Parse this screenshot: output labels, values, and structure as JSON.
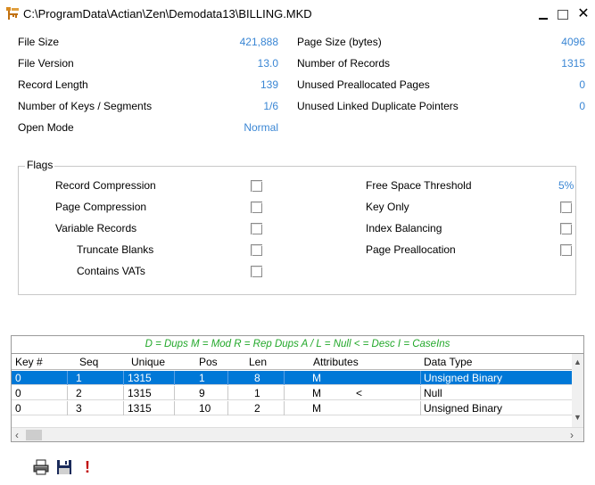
{
  "window": {
    "title": "C:\\ProgramData\\Actian\\Zen\\Demodata13\\BILLING.MKD"
  },
  "info": {
    "left": [
      {
        "label": "File Size",
        "value": "421,888"
      },
      {
        "label": "File Version",
        "value": "13.0"
      },
      {
        "label": "Record Length",
        "value": "139"
      },
      {
        "label": "Number of Keys / Segments",
        "value": "1/6"
      },
      {
        "label": "Open Mode",
        "value": "Normal"
      }
    ],
    "right": [
      {
        "label": "Page Size (bytes)",
        "value": "4096"
      },
      {
        "label": "Number of Records",
        "value": "1315"
      },
      {
        "label": "Unused Preallocated Pages",
        "value": "0"
      },
      {
        "label": "Unused Linked Duplicate Pointers",
        "value": "0"
      }
    ]
  },
  "flags": {
    "title": "Flags",
    "left": [
      {
        "label": "Record Compression",
        "checked": false
      },
      {
        "label": "Page Compression",
        "checked": false
      },
      {
        "label": "Variable Records",
        "checked": false
      },
      {
        "label": "Truncate Blanks",
        "checked": false
      },
      {
        "label": "Contains VATs",
        "checked": false
      }
    ],
    "free_space": {
      "label": "Free Space Threshold",
      "value": "5%"
    },
    "right": [
      {
        "label": "Key Only",
        "checked": false
      },
      {
        "label": "Index Balancing",
        "checked": false
      },
      {
        "label": "Page Preallocation",
        "checked": false
      }
    ]
  },
  "legend": "D = Dups   M = Mod   R = Rep Dups   A / L = Null   < = Desc   I = CaseIns",
  "grid": {
    "columns": [
      "Key #",
      "Seq",
      "Unique",
      "Pos",
      "Len",
      "Attributes",
      "Data Type"
    ],
    "rows": [
      {
        "key": "0",
        "seq": "1",
        "unique": "1315",
        "pos": "1",
        "len": "8",
        "attr1": "M",
        "attr2": "",
        "type": "Unsigned Binary",
        "selected": true
      },
      {
        "key": "0",
        "seq": "2",
        "unique": "1315",
        "pos": "9",
        "len": "1",
        "attr1": "M",
        "attr2": "<",
        "type": "Null",
        "selected": false
      },
      {
        "key": "0",
        "seq": "3",
        "unique": "1315",
        "pos": "10",
        "len": "2",
        "attr1": "M",
        "attr2": "",
        "type": "Unsigned Binary",
        "selected": false
      }
    ]
  },
  "icons": {
    "app": "btrieve-key-icon",
    "print": "printer-icon",
    "save": "floppy-disk-icon",
    "alert": "exclamation-icon"
  },
  "colors": {
    "value": "#3a86d4",
    "legend": "#22a82a",
    "selection": "#0078d7"
  }
}
